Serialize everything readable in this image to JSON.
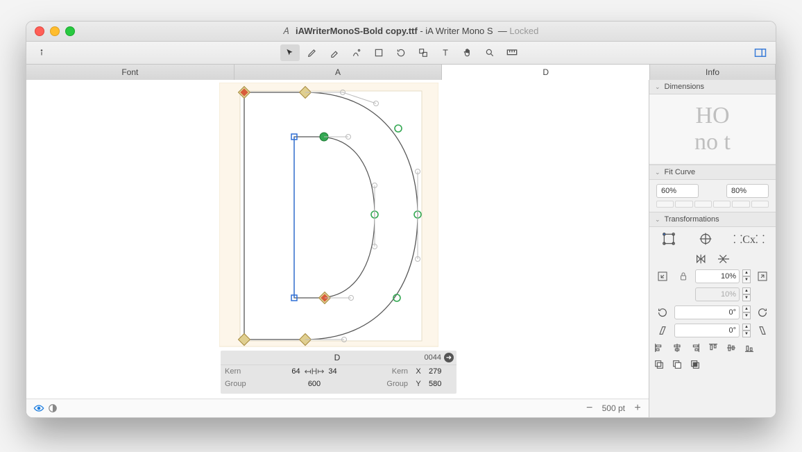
{
  "window": {
    "title_file": "iAWriterMonoS-Bold copy.ttf",
    "title_family": "iA Writer Mono S",
    "title_status": "Locked"
  },
  "tabs": {
    "font": "Font",
    "a": "A",
    "d": "D",
    "info": "Info",
    "active_index": 2
  },
  "glyph": {
    "name": "D",
    "code": "0044",
    "kern_label": "Kern",
    "kern_left": "64",
    "kern_right": "34",
    "group_label": "Group",
    "group_value": "600",
    "coord_x_label": "X",
    "coord_x": "279",
    "coord_y_label": "Y",
    "coord_y": "580"
  },
  "status": {
    "zoom": "500 pt"
  },
  "inspector": {
    "dimensions_label": "Dimensions",
    "dim_preview_top": "HO",
    "dim_preview_bottom": "no t",
    "fitcurve_label": "Fit Curve",
    "fitcurve_low": "60%",
    "fitcurve_high": "80%",
    "transforms_label": "Transformations",
    "scale_value": "10%",
    "scale_value2": "10%",
    "rotate1": "0°",
    "rotate2": "0°"
  }
}
